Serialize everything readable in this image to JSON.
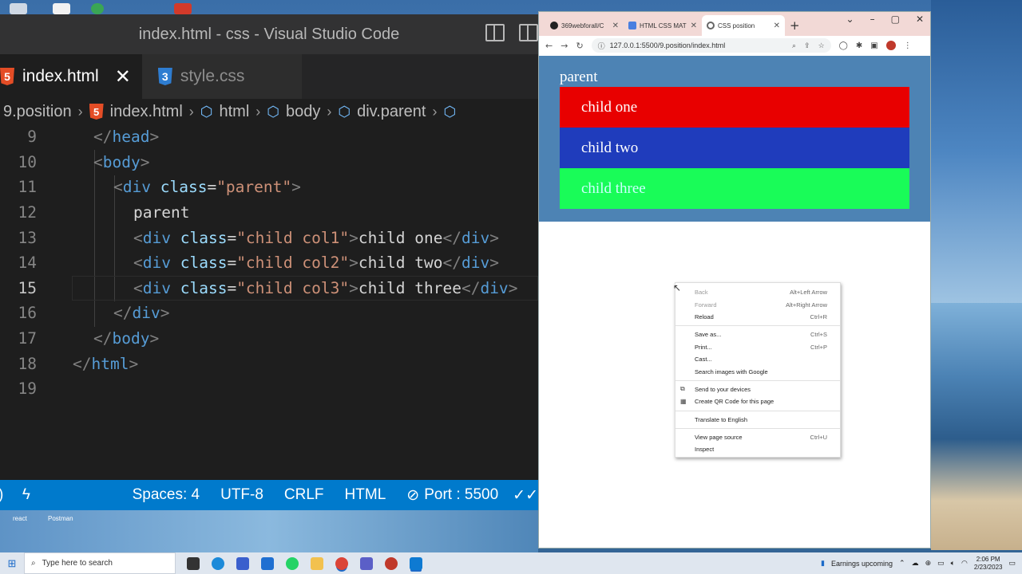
{
  "desktop": {
    "icon_labels": [
      "react",
      "Postman"
    ]
  },
  "vscode": {
    "title": "index.html - css - Visual Studio Code",
    "tabs": [
      {
        "label": "index.html",
        "icon": "html5-icon",
        "active": true
      },
      {
        "label": "style.css",
        "icon": "css3-icon",
        "active": false
      }
    ],
    "breadcrumb": [
      "9.position",
      "index.html",
      "html",
      "body",
      "div.parent"
    ],
    "lines": [
      {
        "num": "9"
      },
      {
        "num": "10"
      },
      {
        "num": "11"
      },
      {
        "num": "12"
      },
      {
        "num": "13"
      },
      {
        "num": "14"
      },
      {
        "num": "15"
      },
      {
        "num": "16"
      },
      {
        "num": "17"
      },
      {
        "num": "18"
      },
      {
        "num": "19"
      }
    ],
    "code": {
      "l9_tag": "head",
      "l10_tag": "body",
      "l11_tag": "div",
      "l11_attr": "class",
      "l11_val": "\"parent\"",
      "l12_text": "parent",
      "l13_tag": "div",
      "l13_attr": "class",
      "l13_val": "\"child col1\"",
      "l13_text": "child one",
      "l13_close": "div",
      "l14_tag": "div",
      "l14_attr": "class",
      "l14_val": "\"child col2\"",
      "l14_text": "child two",
      "l14_close": "div",
      "l15_tag": "div",
      "l15_attr": "class",
      "l15_val": "\"child col3\"",
      "l15_text": "child three",
      "l15_close": "div",
      "l16_tag": "div",
      "l17_tag": "body",
      "l18_tag": "html"
    },
    "status": {
      "spaces": "Spaces: 4",
      "encoding": "UTF-8",
      "eol": "CRLF",
      "language": "HTML",
      "port": "Port : 5500"
    }
  },
  "chrome": {
    "tabs": [
      {
        "label": "369webforall/C",
        "active": false
      },
      {
        "label": "HTML CSS MAT",
        "active": false
      },
      {
        "label": "CSS position",
        "active": true
      }
    ],
    "url": "127.0.0.1:5500/9.position/index.html",
    "page": {
      "parent_label": "parent",
      "children": [
        "child one",
        "child two",
        "child three"
      ]
    },
    "context_menu": [
      {
        "label": "Back",
        "shortcut": "Alt+Left Arrow",
        "disabled": true
      },
      {
        "label": "Forward",
        "shortcut": "Alt+Right Arrow",
        "disabled": true
      },
      {
        "label": "Reload",
        "shortcut": "Ctrl+R",
        "disabled": false
      },
      {
        "label": "Save as...",
        "shortcut": "Ctrl+S",
        "disabled": false
      },
      {
        "label": "Print...",
        "shortcut": "Ctrl+P",
        "disabled": false
      },
      {
        "label": "Cast...",
        "shortcut": "",
        "disabled": false
      },
      {
        "label": "Search images with Google",
        "shortcut": "",
        "disabled": false
      },
      {
        "label": "Send to your devices",
        "shortcut": "",
        "disabled": false
      },
      {
        "label": "Create QR Code for this page",
        "shortcut": "",
        "disabled": false
      },
      {
        "label": "Translate to English",
        "shortcut": "",
        "disabled": false
      },
      {
        "label": "View page source",
        "shortcut": "Ctrl+U",
        "disabled": false
      },
      {
        "label": "Inspect",
        "shortcut": "",
        "disabled": false
      }
    ]
  },
  "taskbar": {
    "search_placeholder": "Type here to search",
    "news": "Earnings upcoming",
    "time": "2:06 PM",
    "date": "2/23/2023"
  },
  "colors": {
    "vscode_status": "#007acc",
    "parent_bg": "#4d83b4",
    "col1": "#e80000",
    "col2": "#1f3cbc",
    "col3": "#19fc58"
  }
}
